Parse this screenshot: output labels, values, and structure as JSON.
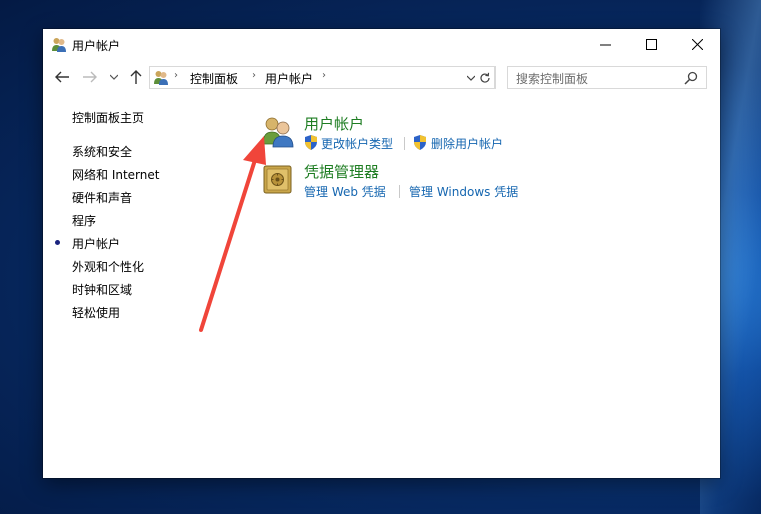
{
  "window": {
    "title": "用户帐户",
    "controls": {
      "minimize": "—",
      "maximize": "☐",
      "close": "✕"
    }
  },
  "navigation": {
    "back": "←",
    "forward": "→",
    "recent": "⌄",
    "up": "↑",
    "breadcrumb": [
      "控制面板",
      "用户帐户"
    ],
    "breadcrumb_separator": "›",
    "dropdown": "⌄",
    "refresh": "↻"
  },
  "search": {
    "placeholder": "搜索控制面板"
  },
  "sidebar": {
    "home": "控制面板主页",
    "items": [
      {
        "label": "系统和安全",
        "active": false
      },
      {
        "label": "网络和 Internet",
        "active": false
      },
      {
        "label": "硬件和声音",
        "active": false
      },
      {
        "label": "程序",
        "active": false
      },
      {
        "label": "用户帐户",
        "active": true
      },
      {
        "label": "外观和个性化",
        "active": false
      },
      {
        "label": "时钟和区域",
        "active": false
      },
      {
        "label": "轻松使用",
        "active": false
      }
    ]
  },
  "categories": [
    {
      "title": "用户帐户",
      "icon": "user-accounts-icon",
      "links": [
        "更改帐户类型",
        "删除用户帐户"
      ]
    },
    {
      "title": "凭据管理器",
      "icon": "credential-vault-icon",
      "links": [
        "管理 Web 凭据",
        "管理 Windows 凭据"
      ]
    }
  ],
  "colors": {
    "category_title": "#1e7d22",
    "link": "#1566b0",
    "annotation_arrow": "#f0453a",
    "active_bullet": "#1a237e"
  }
}
